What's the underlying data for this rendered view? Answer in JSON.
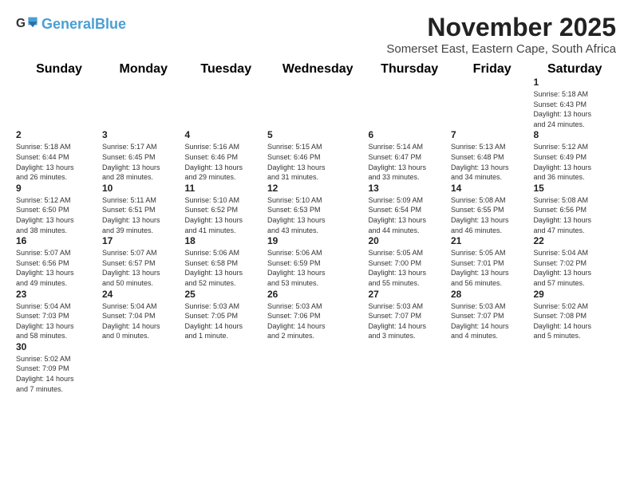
{
  "header": {
    "logo_general": "General",
    "logo_blue": "Blue",
    "month_title": "November 2025",
    "subtitle": "Somerset East, Eastern Cape, South Africa"
  },
  "days_of_week": [
    "Sunday",
    "Monday",
    "Tuesday",
    "Wednesday",
    "Thursday",
    "Friday",
    "Saturday"
  ],
  "weeks": [
    [
      {
        "day": null,
        "info": null
      },
      {
        "day": null,
        "info": null
      },
      {
        "day": null,
        "info": null
      },
      {
        "day": null,
        "info": null
      },
      {
        "day": null,
        "info": null
      },
      {
        "day": null,
        "info": null
      },
      {
        "day": "1",
        "info": "Sunrise: 5:18 AM\nSunset: 6:43 PM\nDaylight: 13 hours\nand 24 minutes."
      }
    ],
    [
      {
        "day": "2",
        "info": "Sunrise: 5:18 AM\nSunset: 6:44 PM\nDaylight: 13 hours\nand 26 minutes."
      },
      {
        "day": "3",
        "info": "Sunrise: 5:17 AM\nSunset: 6:45 PM\nDaylight: 13 hours\nand 28 minutes."
      },
      {
        "day": "4",
        "info": "Sunrise: 5:16 AM\nSunset: 6:46 PM\nDaylight: 13 hours\nand 29 minutes."
      },
      {
        "day": "5",
        "info": "Sunrise: 5:15 AM\nSunset: 6:46 PM\nDaylight: 13 hours\nand 31 minutes."
      },
      {
        "day": "6",
        "info": "Sunrise: 5:14 AM\nSunset: 6:47 PM\nDaylight: 13 hours\nand 33 minutes."
      },
      {
        "day": "7",
        "info": "Sunrise: 5:13 AM\nSunset: 6:48 PM\nDaylight: 13 hours\nand 34 minutes."
      },
      {
        "day": "8",
        "info": "Sunrise: 5:12 AM\nSunset: 6:49 PM\nDaylight: 13 hours\nand 36 minutes."
      }
    ],
    [
      {
        "day": "9",
        "info": "Sunrise: 5:12 AM\nSunset: 6:50 PM\nDaylight: 13 hours\nand 38 minutes."
      },
      {
        "day": "10",
        "info": "Sunrise: 5:11 AM\nSunset: 6:51 PM\nDaylight: 13 hours\nand 39 minutes."
      },
      {
        "day": "11",
        "info": "Sunrise: 5:10 AM\nSunset: 6:52 PM\nDaylight: 13 hours\nand 41 minutes."
      },
      {
        "day": "12",
        "info": "Sunrise: 5:10 AM\nSunset: 6:53 PM\nDaylight: 13 hours\nand 43 minutes."
      },
      {
        "day": "13",
        "info": "Sunrise: 5:09 AM\nSunset: 6:54 PM\nDaylight: 13 hours\nand 44 minutes."
      },
      {
        "day": "14",
        "info": "Sunrise: 5:08 AM\nSunset: 6:55 PM\nDaylight: 13 hours\nand 46 minutes."
      },
      {
        "day": "15",
        "info": "Sunrise: 5:08 AM\nSunset: 6:56 PM\nDaylight: 13 hours\nand 47 minutes."
      }
    ],
    [
      {
        "day": "16",
        "info": "Sunrise: 5:07 AM\nSunset: 6:56 PM\nDaylight: 13 hours\nand 49 minutes."
      },
      {
        "day": "17",
        "info": "Sunrise: 5:07 AM\nSunset: 6:57 PM\nDaylight: 13 hours\nand 50 minutes."
      },
      {
        "day": "18",
        "info": "Sunrise: 5:06 AM\nSunset: 6:58 PM\nDaylight: 13 hours\nand 52 minutes."
      },
      {
        "day": "19",
        "info": "Sunrise: 5:06 AM\nSunset: 6:59 PM\nDaylight: 13 hours\nand 53 minutes."
      },
      {
        "day": "20",
        "info": "Sunrise: 5:05 AM\nSunset: 7:00 PM\nDaylight: 13 hours\nand 55 minutes."
      },
      {
        "day": "21",
        "info": "Sunrise: 5:05 AM\nSunset: 7:01 PM\nDaylight: 13 hours\nand 56 minutes."
      },
      {
        "day": "22",
        "info": "Sunrise: 5:04 AM\nSunset: 7:02 PM\nDaylight: 13 hours\nand 57 minutes."
      }
    ],
    [
      {
        "day": "23",
        "info": "Sunrise: 5:04 AM\nSunset: 7:03 PM\nDaylight: 13 hours\nand 58 minutes."
      },
      {
        "day": "24",
        "info": "Sunrise: 5:04 AM\nSunset: 7:04 PM\nDaylight: 14 hours\nand 0 minutes."
      },
      {
        "day": "25",
        "info": "Sunrise: 5:03 AM\nSunset: 7:05 PM\nDaylight: 14 hours\nand 1 minute."
      },
      {
        "day": "26",
        "info": "Sunrise: 5:03 AM\nSunset: 7:06 PM\nDaylight: 14 hours\nand 2 minutes."
      },
      {
        "day": "27",
        "info": "Sunrise: 5:03 AM\nSunset: 7:07 PM\nDaylight: 14 hours\nand 3 minutes."
      },
      {
        "day": "28",
        "info": "Sunrise: 5:03 AM\nSunset: 7:07 PM\nDaylight: 14 hours\nand 4 minutes."
      },
      {
        "day": "29",
        "info": "Sunrise: 5:02 AM\nSunset: 7:08 PM\nDaylight: 14 hours\nand 5 minutes."
      }
    ],
    [
      {
        "day": "30",
        "info": "Sunrise: 5:02 AM\nSunset: 7:09 PM\nDaylight: 14 hours\nand 7 minutes."
      },
      {
        "day": null,
        "info": null
      },
      {
        "day": null,
        "info": null
      },
      {
        "day": null,
        "info": null
      },
      {
        "day": null,
        "info": null
      },
      {
        "day": null,
        "info": null
      },
      {
        "day": null,
        "info": null
      }
    ]
  ]
}
